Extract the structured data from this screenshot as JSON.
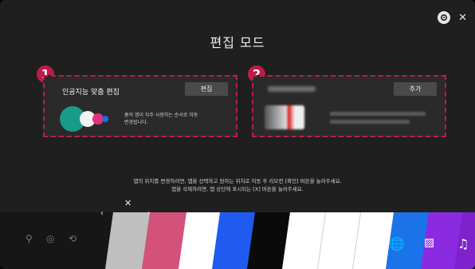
{
  "header": {
    "title": "편집 모드"
  },
  "panels": [
    {
      "badge": "1",
      "title": "인공지능 맞춤 편집",
      "button": "편집",
      "desc_line1": "홈의 앱이 자주 사용하는 순서로 자동",
      "desc_line2": "변경됩니다."
    },
    {
      "badge": "2",
      "button": "추가"
    }
  ],
  "instructions": {
    "line1": "앱의 위치를 변경하려면, 앱을 선택하고 원하는 위치로 이동 후 리모컨 [확인] 버튼을 눌러주세요.",
    "line2": "앱을 삭제하려면, 앱 상단에 표시되는 [X] 버튼을 눌러주세요."
  },
  "icons": {
    "settings": "gear-icon",
    "close": "close-icon",
    "bottom_left": [
      "search-icon",
      "input-icon",
      "guide-icon"
    ]
  },
  "tile_colors": [
    "#bfbfbf",
    "#d2527a",
    "#ffffff",
    "#1f5bf0",
    "#0a0a0a",
    "#ffffff",
    "#ffffff",
    "#ffffff",
    "#1a73e8",
    "#8a2be2",
    "#7e22ce"
  ],
  "accent": "#c01a4a"
}
